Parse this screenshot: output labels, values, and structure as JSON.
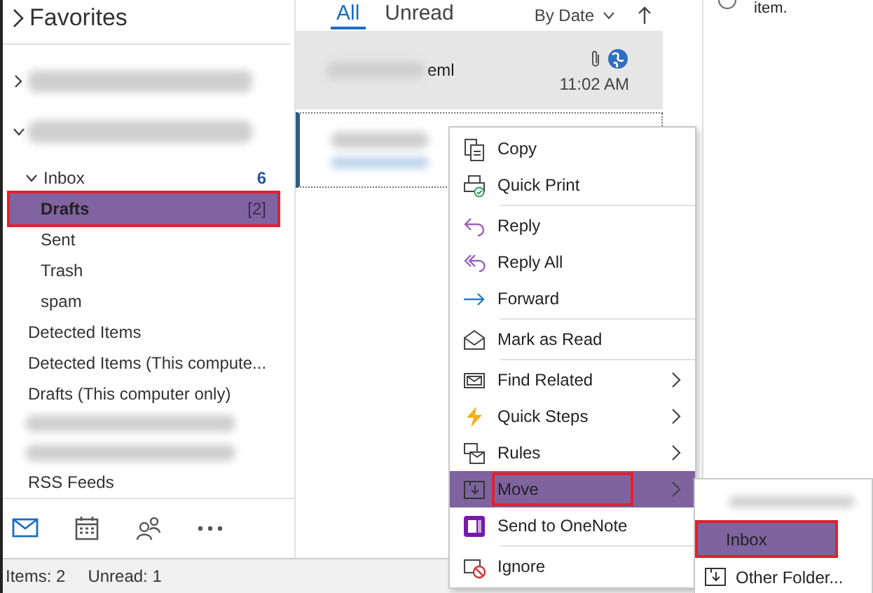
{
  "sidebar": {
    "favorites": {
      "label": "Favorites",
      "expanded": false
    },
    "tree": [
      {
        "kind": "blurred",
        "expanded": false
      },
      {
        "kind": "blurred",
        "expanded": true,
        "children": [
          {
            "kind": "folder",
            "label": "Inbox",
            "count": "6",
            "expanded": true,
            "selected": false,
            "children": [
              {
                "kind": "folder",
                "label": "Drafts",
                "count": "[2]",
                "selected": true,
                "highlighted": true
              },
              {
                "kind": "folder",
                "label": "Sent",
                "selected": false
              },
              {
                "kind": "folder",
                "label": "Trash",
                "selected": false
              },
              {
                "kind": "folder",
                "label": "spam",
                "selected": false
              }
            ]
          },
          {
            "kind": "folder",
            "label": "Detected Items",
            "selected": false
          },
          {
            "kind": "folder",
            "label": "Detected Items (This compute...",
            "selected": false
          },
          {
            "kind": "folder",
            "label": "Drafts (This computer only)",
            "selected": false
          },
          {
            "kind": "blurred"
          },
          {
            "kind": "blurred"
          },
          {
            "kind": "folder",
            "label": "RSS Feeds",
            "selected": false
          }
        ]
      }
    ],
    "nav": [
      {
        "selected": true
      },
      {
        "selected": false
      },
      {
        "selected": false
      },
      {
        "selected": false
      }
    ]
  },
  "message_list": {
    "tabs": [
      {
        "label": "All",
        "selected": true
      },
      {
        "label": "Unread",
        "selected": false
      }
    ],
    "sort": "By Date",
    "messages": [
      {
        "subject_suffix": "eml",
        "time": "11:02 AM",
        "attachment": true,
        "selected": true,
        "focused": false
      },
      {
        "selected": false,
        "focused": true
      }
    ]
  },
  "reading_pane": {
    "text": "item."
  },
  "context_menu": {
    "groups": [
      [
        {
          "label": "Copy",
          "submenu": false,
          "selected": false
        },
        {
          "label": "Quick Print",
          "submenu": false,
          "selected": false
        }
      ],
      [
        {
          "label": "Reply",
          "submenu": false,
          "selected": false
        },
        {
          "label": "Reply All",
          "submenu": false,
          "selected": false
        },
        {
          "label": "Forward",
          "submenu": false,
          "selected": false
        }
      ],
      [
        {
          "label": "Mark as Read",
          "submenu": false,
          "selected": false
        }
      ],
      [
        {
          "label": "Find Related",
          "submenu": true,
          "selected": false
        },
        {
          "label": "Quick Steps",
          "submenu": true,
          "selected": false
        },
        {
          "label": "Rules",
          "submenu": true,
          "selected": false
        },
        {
          "label": "Move",
          "submenu": true,
          "selected": true,
          "highlighted": true
        },
        {
          "label": "Send to OneNote",
          "submenu": false,
          "selected": false
        }
      ],
      [
        {
          "label": "Ignore",
          "submenu": false,
          "selected": false
        }
      ]
    ]
  },
  "submenu": {
    "items": [
      {
        "kind": "blurred",
        "selected": false
      },
      {
        "kind": "folder",
        "label": "Inbox",
        "selected": true,
        "highlighted": true
      },
      {
        "kind": "command",
        "label": "Other Folder...",
        "selected": false
      }
    ]
  },
  "status_bar": {
    "items": "Items: 2",
    "unread": "Unread: 1"
  }
}
